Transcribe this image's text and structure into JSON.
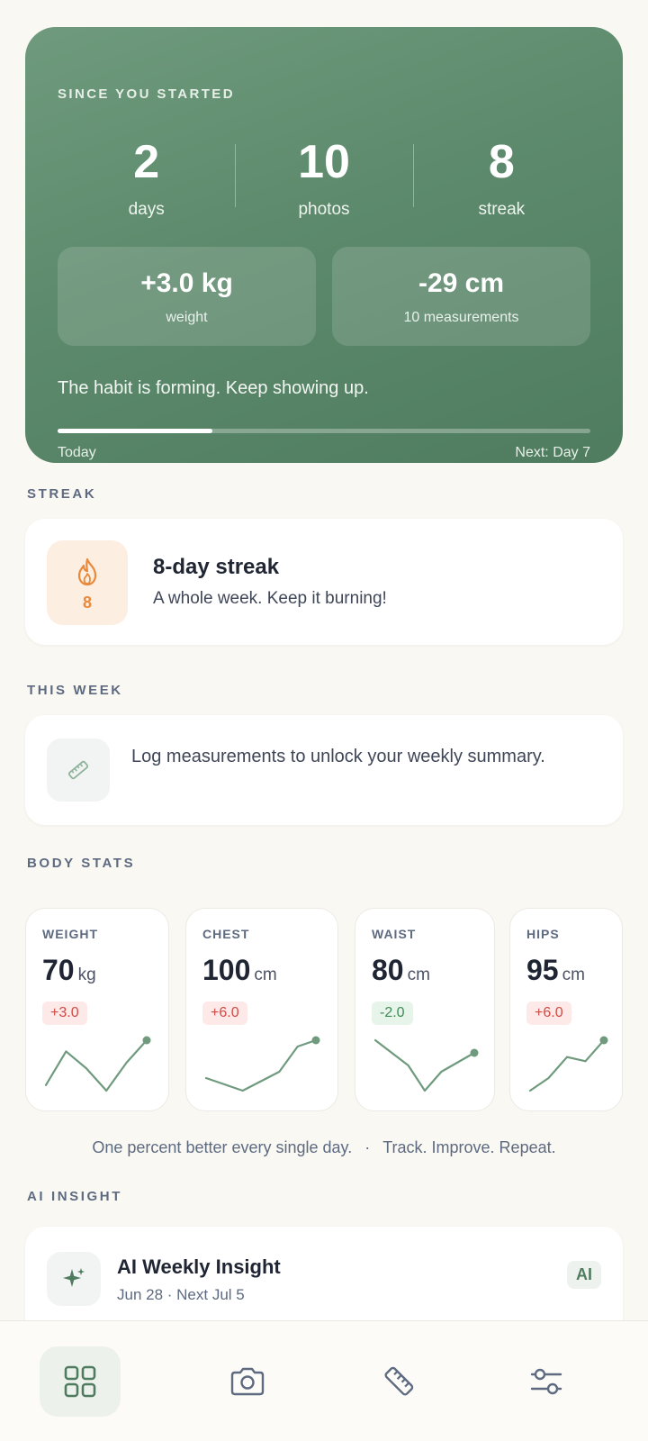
{
  "hero": {
    "eyebrow": "SINCE YOU STARTED",
    "stats": [
      {
        "value": "2",
        "label": "days"
      },
      {
        "value": "10",
        "label": "photos"
      },
      {
        "value": "8",
        "label": "streak"
      }
    ],
    "boxes": [
      {
        "value": "+3.0 kg",
        "label": "weight"
      },
      {
        "value": "-29 cm",
        "label": "10 measurements"
      }
    ],
    "message": "The habit is forming. Keep showing up.",
    "progress_fraction": 0.29,
    "start_label": "Today",
    "next_label": "Next: Day 7"
  },
  "streak": {
    "section": "STREAK",
    "count": "8",
    "title": "8-day streak",
    "subtitle": "A whole week. Keep it burning!"
  },
  "week": {
    "section": "THIS WEEK",
    "text": "Log measurements to unlock your weekly summary."
  },
  "body_stats": {
    "section": "BODY STATS",
    "items": [
      {
        "name": "WEIGHT",
        "value": "70",
        "unit": "kg",
        "delta": "+3.0",
        "trend": "up",
        "spark": [
          66,
          69,
          67.5,
          65.5,
          68,
          70
        ]
      },
      {
        "name": "CHEST",
        "value": "100",
        "unit": "cm",
        "delta": "+6.0",
        "trend": "up",
        "spark": [
          94,
          93,
          92,
          93.5,
          95,
          99,
          100
        ]
      },
      {
        "name": "WAIST",
        "value": "80",
        "unit": "cm",
        "delta": "-2.0",
        "trend": "down",
        "spark": [
          82,
          80,
          78,
          74,
          77,
          78.5,
          80
        ]
      },
      {
        "name": "HIPS",
        "value": "95",
        "unit": "cm",
        "delta": "+6.0",
        "trend": "up",
        "spark": [
          89,
          90.5,
          93,
          92.5,
          95
        ]
      }
    ]
  },
  "quote": {
    "left": "One percent better every single day.",
    "separator": "·",
    "right": "Track. Improve. Repeat."
  },
  "ai": {
    "section": "AI INSIGHT",
    "title": "AI Weekly Insight",
    "subtitle": "Jun 28 · Next Jul 5",
    "badge": "AI"
  },
  "nav": {
    "items": [
      "dashboard-icon",
      "camera-icon",
      "ruler-icon",
      "sliders-icon"
    ],
    "active_index": 0
  },
  "colors": {
    "accent": "#5d8a6c",
    "streak": "#e8893b",
    "up": "#cf4b45",
    "down": "#3f8a55",
    "spark": "#6f9a7d"
  }
}
